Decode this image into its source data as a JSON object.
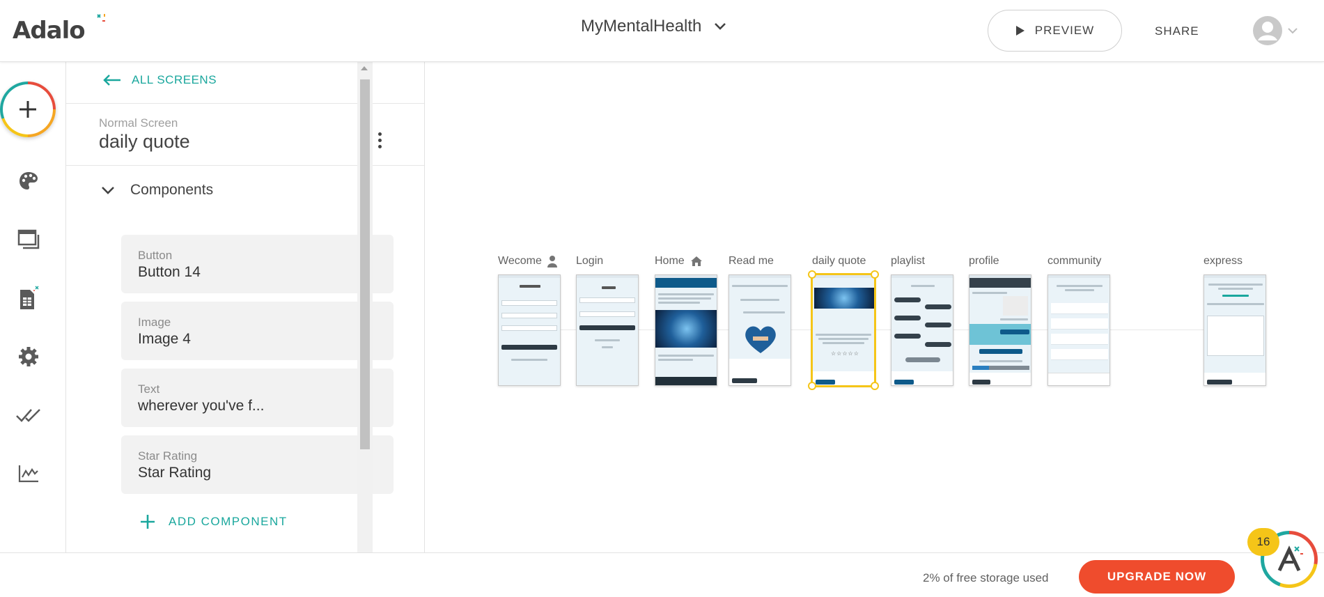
{
  "app": {
    "logo_text": "Adalo",
    "project_name": "MyMentalHealth",
    "preview_label": "PREVIEW",
    "share_label": "SHARE"
  },
  "rail": {
    "items": [
      "add-icon",
      "palette-icon",
      "screens-icon",
      "database-icon",
      "settings-icon",
      "publish-check-icon",
      "analytics-icon"
    ]
  },
  "panel": {
    "back_label": "ALL SCREENS",
    "screen_type": "Normal Screen",
    "screen_name": "daily quote",
    "components_label": "Components",
    "components": [
      {
        "type": "Button",
        "name": "Button 14"
      },
      {
        "type": "Image",
        "name": "Image 4"
      },
      {
        "type": "Text",
        "name": "wherever you've f..."
      },
      {
        "type": "Star Rating",
        "name": "Star Rating"
      }
    ],
    "add_component_label": "ADD COMPONENT"
  },
  "canvas": {
    "screens": [
      {
        "label": "Wecome",
        "icon": "person-icon"
      },
      {
        "label": "Login",
        "icon": ""
      },
      {
        "label": "Home",
        "icon": "home-icon"
      },
      {
        "label": "Read me",
        "icon": ""
      },
      {
        "label": "daily quote",
        "icon": "",
        "selected": true
      },
      {
        "label": "playlist",
        "icon": ""
      },
      {
        "label": "profile",
        "icon": ""
      },
      {
        "label": "community",
        "icon": ""
      },
      {
        "label": "express",
        "icon": ""
      }
    ]
  },
  "footer": {
    "storage_text": "2% of free storage used",
    "upgrade_label": "UPGRADE NOW",
    "notification_count": "16"
  },
  "colors": {
    "accent": "#1aa79d",
    "upgrade": "#ef4c2d",
    "selection": "#f5c518"
  }
}
